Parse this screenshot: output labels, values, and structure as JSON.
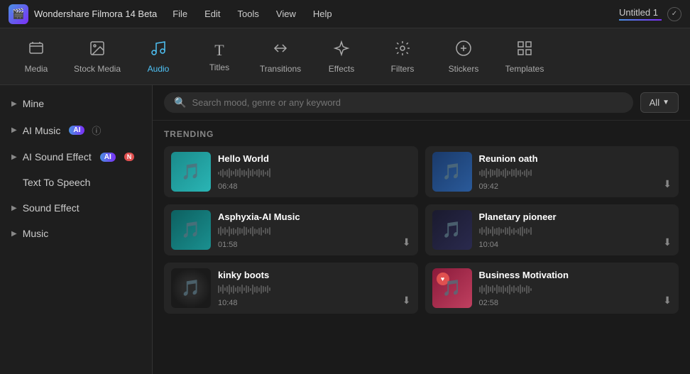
{
  "app": {
    "name": "Wondershare Filmora 14 Beta",
    "project_title": "Untitled 1"
  },
  "menu": {
    "items": [
      "File",
      "Edit",
      "Tools",
      "View",
      "Help"
    ]
  },
  "toolbar": {
    "items": [
      {
        "id": "media",
        "label": "Media",
        "icon": "🎬",
        "active": false
      },
      {
        "id": "stock-media",
        "label": "Stock Media",
        "icon": "📷",
        "active": false
      },
      {
        "id": "audio",
        "label": "Audio",
        "icon": "🎵",
        "active": true
      },
      {
        "id": "titles",
        "label": "Titles",
        "icon": "T",
        "active": false
      },
      {
        "id": "transitions",
        "label": "Transitions",
        "icon": "↔",
        "active": false
      },
      {
        "id": "effects",
        "label": "Effects",
        "icon": "✨",
        "active": false
      },
      {
        "id": "filters",
        "label": "Filters",
        "icon": "🎨",
        "active": false
      },
      {
        "id": "stickers",
        "label": "Stickers",
        "icon": "⭐",
        "active": false
      },
      {
        "id": "templates",
        "label": "Templates",
        "icon": "⊞",
        "active": false
      }
    ]
  },
  "sidebar": {
    "items": [
      {
        "id": "mine",
        "label": "Mine",
        "has_arrow": true,
        "badge": null
      },
      {
        "id": "ai-music",
        "label": "AI Music",
        "has_arrow": true,
        "badge": "AI"
      },
      {
        "id": "ai-sound-effect",
        "label": "AI Sound Effect",
        "has_arrow": true,
        "badge": "AI",
        "badge2": "NEW"
      },
      {
        "id": "text-to-speech",
        "label": "Text To Speech",
        "has_arrow": false
      },
      {
        "id": "sound-effect",
        "label": "Sound Effect",
        "has_arrow": true
      },
      {
        "id": "music",
        "label": "Music",
        "has_arrow": true
      }
    ]
  },
  "search": {
    "placeholder": "Search mood, genre or any keyword",
    "filter_label": "All"
  },
  "content": {
    "section_label": "TRENDING",
    "tracks": [
      {
        "id": "hello-world",
        "name": "Hello World",
        "duration": "06:48",
        "thumb_class": "thumb-blue",
        "has_download": false,
        "has_heart": false
      },
      {
        "id": "reunion-oath",
        "name": "Reunion oath",
        "duration": "09:42",
        "thumb_class": "thumb-dark-blue",
        "has_download": true,
        "has_heart": false
      },
      {
        "id": "asphyxia-ai-music",
        "name": "Asphyxia-AI Music",
        "duration": "01:58",
        "thumb_class": "thumb-teal",
        "has_download": true,
        "has_heart": false
      },
      {
        "id": "planetary-pioneer",
        "name": "Planetary pioneer",
        "duration": "10:04",
        "thumb_class": "thumb-dark",
        "has_download": true,
        "has_heart": false
      },
      {
        "id": "kinky-boots",
        "name": "kinky boots",
        "duration": "10:48",
        "thumb_class": "thumb-vinyl",
        "has_download": true,
        "has_heart": false
      },
      {
        "id": "business-motivation",
        "name": "Business Motivation",
        "duration": "02:58",
        "thumb_class": "thumb-pink-red",
        "has_download": true,
        "has_heart": true
      }
    ]
  }
}
